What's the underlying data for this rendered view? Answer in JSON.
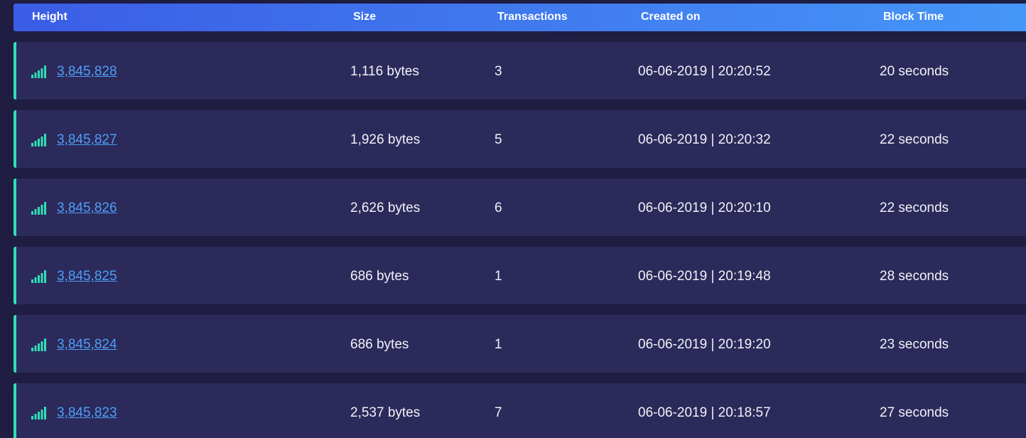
{
  "table": {
    "columns": {
      "height": "Height",
      "size": "Size",
      "transactions": "Transactions",
      "created_on": "Created on",
      "block_time": "Block Time"
    },
    "icon": "signal-bars-icon",
    "accent_color": "#2fe0b5",
    "link_color": "#4f9ff5",
    "rows": [
      {
        "height": "3,845,828",
        "size": "1,116 bytes",
        "transactions": "3",
        "created_on": "06-06-2019 | 20:20:52",
        "block_time": "20 seconds"
      },
      {
        "height": "3,845,827",
        "size": "1,926 bytes",
        "transactions": "5",
        "created_on": "06-06-2019 | 20:20:32",
        "block_time": "22 seconds"
      },
      {
        "height": "3,845,826",
        "size": "2,626 bytes",
        "transactions": "6",
        "created_on": "06-06-2019 | 20:20:10",
        "block_time": "22 seconds"
      },
      {
        "height": "3,845,825",
        "size": "686 bytes",
        "transactions": "1",
        "created_on": "06-06-2019 | 20:19:48",
        "block_time": "28 seconds"
      },
      {
        "height": "3,845,824",
        "size": "686 bytes",
        "transactions": "1",
        "created_on": "06-06-2019 | 20:19:20",
        "block_time": "23 seconds"
      },
      {
        "height": "3,845,823",
        "size": "2,537 bytes",
        "transactions": "7",
        "created_on": "06-06-2019 | 20:18:57",
        "block_time": "27 seconds"
      }
    ]
  }
}
